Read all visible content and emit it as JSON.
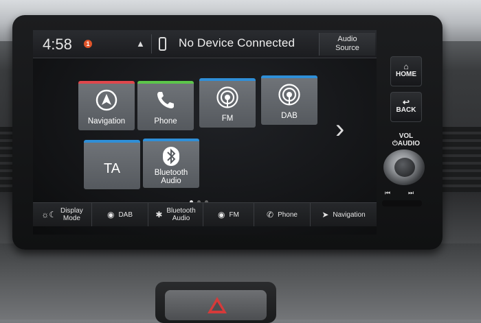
{
  "status_bar": {
    "time": "4:58",
    "alert_count": "1",
    "device_status": "No Device Connected",
    "audio_source_line1": "Audio",
    "audio_source_line2": "Source"
  },
  "apps": [
    {
      "label": "Navigation",
      "accent": "#e0474c",
      "icon": "compass-icon"
    },
    {
      "label": "Phone",
      "accent": "#5cc64a",
      "icon": "phone-handset-icon"
    },
    {
      "label": "FM",
      "accent": "#2f8fd8",
      "icon": "radio-broadcast-icon"
    },
    {
      "label": "DAB",
      "accent": "#2f8fd8",
      "icon": "radio-broadcast-icon"
    },
    {
      "label": "TA",
      "accent": "#2f8fd8",
      "icon": ""
    },
    {
      "label_line1": "Bluetooth",
      "label_line2": "Audio",
      "accent": "#2f8fd8",
      "icon": "bluetooth-icon"
    }
  ],
  "pager": {
    "total": 3,
    "active": 0
  },
  "shortcuts": [
    {
      "line1": "Display",
      "line2": "Mode",
      "icon": "display-mode-icon"
    },
    {
      "line1": "DAB",
      "line2": "",
      "icon": "radio-broadcast-icon"
    },
    {
      "line1": "Bluetooth",
      "line2": "Audio",
      "icon": "bluetooth-icon"
    },
    {
      "line1": "FM",
      "line2": "",
      "icon": "radio-broadcast-icon"
    },
    {
      "line1": "Phone",
      "line2": "",
      "icon": "phone-handset-icon"
    },
    {
      "line1": "Navigation",
      "line2": "",
      "icon": "compass-icon"
    }
  ],
  "hardware": {
    "home_label": "HOME",
    "back_label": "BACK",
    "vol_label": "VOL",
    "audio_label": "AUDIO"
  }
}
